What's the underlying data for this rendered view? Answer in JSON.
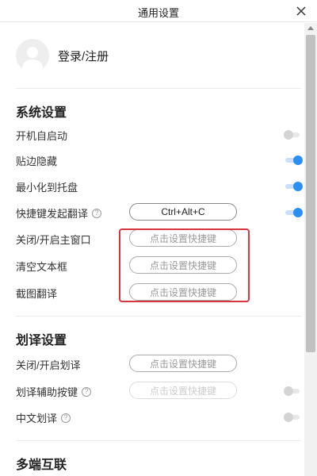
{
  "window": {
    "title": "通用设置",
    "close_icon": "close-icon"
  },
  "user": {
    "login_label": "登录/注册"
  },
  "system_settings": {
    "title": "系统设置",
    "autostart": {
      "label": "开机自启动",
      "enabled": false
    },
    "edge_hide": {
      "label": "贴边隐藏",
      "enabled": true
    },
    "minimize_to_tray": {
      "label": "最小化到托盘",
      "enabled": true
    },
    "hotkey_translate": {
      "label": "快捷键发起翻译",
      "value": "Ctrl+Alt+C",
      "enabled": true
    },
    "toggle_main_window": {
      "label": "关闭/开启主窗口",
      "value": "点击设置快捷键"
    },
    "clear_textbox": {
      "label": "清空文本框",
      "value": "点击设置快捷键"
    },
    "screenshot_translate": {
      "label": "截图翻译",
      "value": "点击设置快捷键"
    }
  },
  "selection_settings": {
    "title": "划译设置",
    "toggle_selection": {
      "label": "关闭/开启划译",
      "value": "点击设置快捷键"
    },
    "selection_assist_key": {
      "label": "划译辅助按键",
      "value": "点击设置快捷键",
      "enabled": false
    },
    "chinese_selection": {
      "label": "中文划译",
      "enabled": false
    }
  },
  "multi_device": {
    "title": "多端互联"
  },
  "colors": {
    "accent": "#2b8ef3",
    "highlight_box": "#d6363d"
  }
}
